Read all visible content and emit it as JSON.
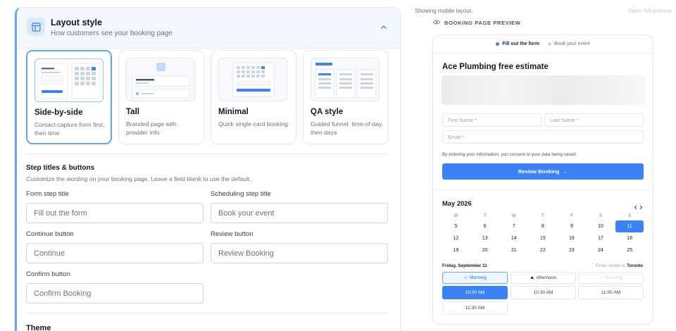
{
  "settings": {
    "title": "Layout style",
    "subtitle": "How customers see your booking page",
    "layouts": [
      {
        "title": "Side-by-side",
        "desc": "Contact-capture form first, then time",
        "selected": true
      },
      {
        "title": "Tall",
        "desc": "Branded page with provider info",
        "selected": false
      },
      {
        "title": "Minimal",
        "desc": "Quick single-card booking",
        "selected": false
      },
      {
        "title": "QA style",
        "desc": "Guided funnel: time-of-day, then days",
        "selected": false
      }
    ],
    "step_section": {
      "title": "Step titles & buttons",
      "subtitle": "Customize the wording on your booking page. Leave a field blank to use the default.",
      "fields": {
        "form_step": {
          "label": "Form step title",
          "placeholder": "Fill out the form"
        },
        "scheduling_step": {
          "label": "Scheduling step title",
          "placeholder": "Book your event"
        },
        "continue_button": {
          "label": "Continue button",
          "placeholder": "Continue"
        },
        "review_button": {
          "label": "Review button",
          "placeholder": "Review Booking"
        },
        "confirm_button": {
          "label": "Confirm button",
          "placeholder": "Confirm Booking"
        }
      }
    },
    "theme_title": "Theme"
  },
  "preview": {
    "showing_text": "Showing mobile layout.",
    "open_full": "Open full preview",
    "label": "BOOKING PAGE PREVIEW",
    "steps": [
      {
        "label": "Fill out the form",
        "active": true
      },
      {
        "label": "Book your event",
        "active": false
      }
    ],
    "title": "Ace Plumbing free estimate",
    "first_name": "First Name *",
    "last_name": "Last Name *",
    "email": "Email *",
    "consent": "By entering your information, you consent to your data being saved.",
    "review_button": "Review Booking",
    "calendar": {
      "month": "May 2026",
      "weekdays": [
        "M",
        "T",
        "W",
        "T",
        "F",
        "S",
        "S"
      ],
      "weeks": [
        [
          "5",
          "6",
          "7",
          "8",
          "9",
          "10",
          "11"
        ],
        [
          "12",
          "13",
          "14",
          "15",
          "16",
          "17",
          "18"
        ],
        [
          "19",
          "20",
          "21",
          "22",
          "23",
          "24",
          "25"
        ]
      ],
      "selected_day": "11"
    },
    "selected_date": "Friday, September 11",
    "tz_prefix": "Times shown in",
    "tz_city": "Toronto",
    "periods": [
      "Morning",
      "Afternoon",
      "Evening"
    ],
    "times": [
      "10:00 AM",
      "10:30 AM",
      "11:00 AM",
      "11:30 AM"
    ]
  },
  "colors": {
    "accent": "#3b82f6",
    "selected_border": "#60a5fa",
    "header_bg": "#f3f8fe"
  }
}
